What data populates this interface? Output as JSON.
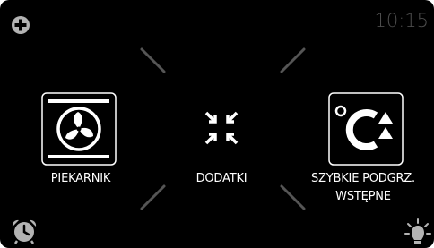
{
  "status": {
    "time": "10:15"
  },
  "modes": [
    {
      "id": "oven",
      "label": "PIEKARNIK",
      "icon": "fan-icon"
    },
    {
      "id": "extras",
      "label": "DODATKI",
      "icon": "arrows-inward-icon"
    },
    {
      "id": "fast-preheat",
      "label_line1": "SZYBKIE PODGRZ.",
      "label_line2": "WSTĘPNE",
      "icon": "degree-celsius-up-icon"
    }
  ],
  "icons": {
    "top_left": "plus-circle-icon",
    "bottom_left": "alarm-clock-icon",
    "bottom_right": "oven-light-icon"
  },
  "colors": {
    "background": "#000000",
    "foreground": "#ffffff",
    "clock": "#4d4d4d",
    "deco_lines": "#555555",
    "icons_dim": "#b3b3b3"
  }
}
